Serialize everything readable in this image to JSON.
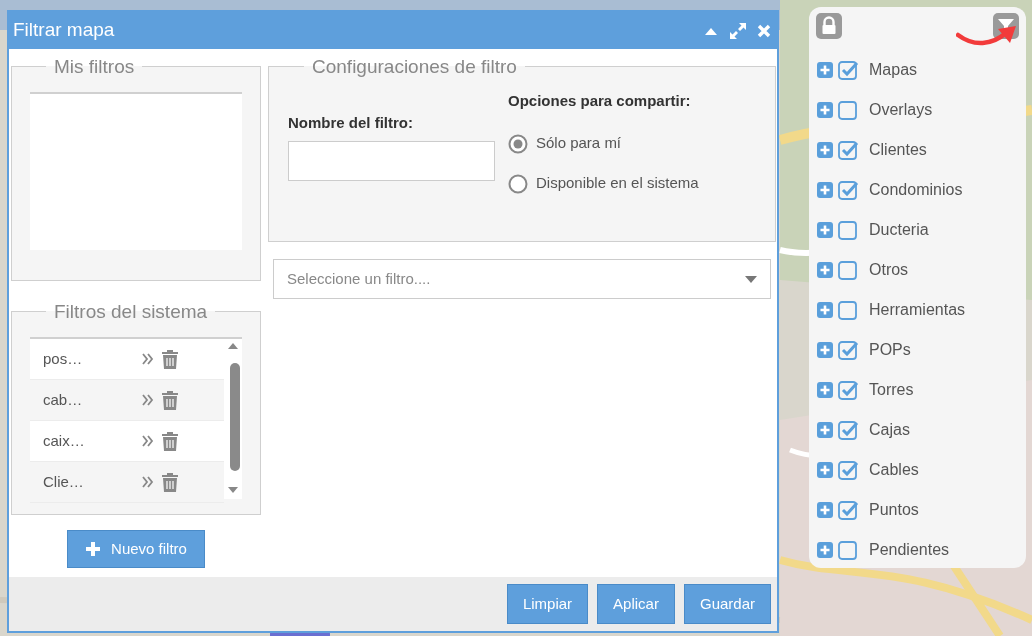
{
  "dialog": {
    "title": "Filtrar mapa",
    "my_filters": {
      "legend": "Mis filtros"
    },
    "system_filters": {
      "legend": "Filtros del sistema",
      "items": [
        {
          "name": "pos…"
        },
        {
          "name": "cab…"
        },
        {
          "name": "caix…"
        },
        {
          "name": "Clie…"
        }
      ]
    },
    "new_button": "Nuevo filtro",
    "config": {
      "legend": "Configuraciones de filtro",
      "name_label": "Nombre del filtro:",
      "share_label": "Opciones para compartir:",
      "share_options": [
        {
          "label": "Sólo para mí",
          "selected": true
        },
        {
          "label": "Disponible en el sistema",
          "selected": false
        }
      ]
    },
    "filter_select": {
      "placeholder": "Seleccione un filtro...."
    },
    "footer_buttons": [
      "Limpiar",
      "Aplicar",
      "Guardar"
    ]
  },
  "layers": [
    {
      "label": "Mapas",
      "checked": true
    },
    {
      "label": "Overlays",
      "checked": false
    },
    {
      "label": "Clientes",
      "checked": true
    },
    {
      "label": "Condominios",
      "checked": true
    },
    {
      "label": "Ducteria",
      "checked": false
    },
    {
      "label": "Otros",
      "checked": false
    },
    {
      "label": "Herramientas",
      "checked": false
    },
    {
      "label": "POPs",
      "checked": true
    },
    {
      "label": "Torres",
      "checked": true
    },
    {
      "label": "Cajas",
      "checked": true
    },
    {
      "label": "Cables",
      "checked": true
    },
    {
      "label": "Puntos",
      "checked": true
    },
    {
      "label": "Pendientes",
      "checked": false
    }
  ]
}
